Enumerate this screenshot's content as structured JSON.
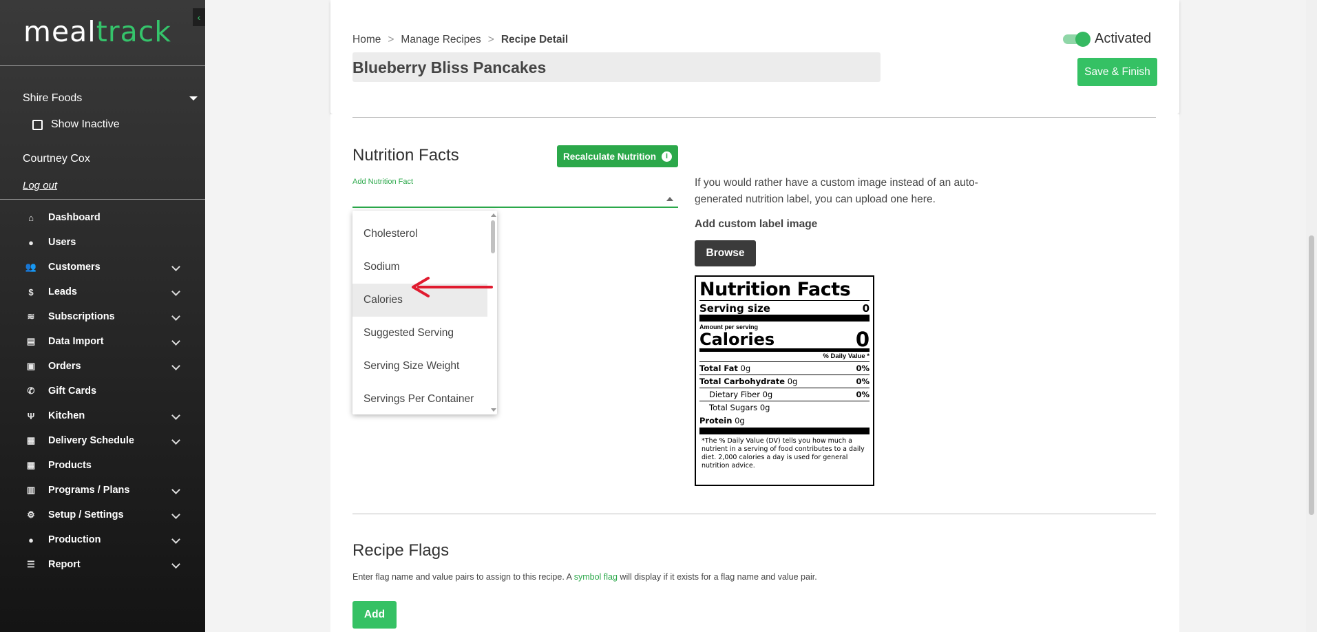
{
  "brand": {
    "part1": "meal",
    "part2": "track",
    "accent": "#35c46b"
  },
  "sidebar": {
    "company": "Shire Foods",
    "show_inactive": "Show Inactive",
    "user_name": "Courtney Cox",
    "logout": "Log out",
    "items": [
      {
        "label": "Dashboard",
        "icon": "home-icon",
        "glyph": "⌂",
        "expandable": false
      },
      {
        "label": "Users",
        "icon": "user-icon",
        "glyph": "●",
        "expandable": false
      },
      {
        "label": "Customers",
        "icon": "users-icon",
        "glyph": "👥",
        "expandable": true
      },
      {
        "label": "Leads",
        "icon": "dollar-icon",
        "glyph": "$",
        "expandable": true
      },
      {
        "label": "Subscriptions",
        "icon": "layers-icon",
        "glyph": "≋",
        "expandable": true
      },
      {
        "label": "Data Import",
        "icon": "file-icon",
        "glyph": "▤",
        "expandable": true
      },
      {
        "label": "Orders",
        "icon": "bag-icon",
        "glyph": "▣",
        "expandable": true
      },
      {
        "label": "Gift Cards",
        "icon": "phone-icon",
        "glyph": "✆",
        "expandable": false
      },
      {
        "label": "Kitchen",
        "icon": "utensils-icon",
        "glyph": "Ψ",
        "expandable": true
      },
      {
        "label": "Delivery Schedule",
        "icon": "calendar-icon",
        "glyph": "▦",
        "expandable": true
      },
      {
        "label": "Products",
        "icon": "calendar-icon",
        "glyph": "▦",
        "expandable": false
      },
      {
        "label": "Programs / Plans",
        "icon": "clipboard-icon",
        "glyph": "▥",
        "expandable": true
      },
      {
        "label": "Setup / Settings",
        "icon": "gear-icon",
        "glyph": "⚙",
        "expandable": true
      },
      {
        "label": "Production",
        "icon": "user-icon",
        "glyph": "●",
        "expandable": true
      },
      {
        "label": "Report",
        "icon": "list-icon",
        "glyph": "☰",
        "expandable": true
      }
    ]
  },
  "header": {
    "breadcrumb": [
      "Home",
      "Manage Recipes",
      "Recipe Detail"
    ],
    "breadcrumb_sep": ">",
    "title": "Blueberry Bliss Pancakes",
    "status": "Activated",
    "save_label": "Save & Finish"
  },
  "nutrition": {
    "heading": "Nutrition Facts",
    "recalc_label": "Recalculate Nutrition",
    "add_label": "Add Nutrition Fact",
    "dropdown_options": [
      "Cholesterol",
      "Sodium",
      "Calories",
      "Suggested Serving",
      "Serving Size Weight",
      "Servings Per Container"
    ],
    "highlighted_option": "Calories",
    "custom_text": "If you would rather have a custom image instead of an auto-generated nutrition label, you can upload one here.",
    "custom_label": "Add custom label image",
    "browse_label": "Browse"
  },
  "label": {
    "title": "Nutrition Facts",
    "serving_size": "Serving size",
    "serving_value": "0",
    "amount_per": "Amount per serving",
    "calories": "Calories",
    "calories_value": "0",
    "dv_header": "% Daily Value *",
    "total_fat": "Total Fat",
    "total_fat_v": "0g",
    "total_fat_dv": "0%",
    "total_carb": "Total Carbohydrate",
    "total_carb_v": "0g",
    "total_carb_dv": "0%",
    "fiber": "Dietary Fiber",
    "fiber_v": "0g",
    "fiber_dv": "0%",
    "sugars": "Total Sugars",
    "sugars_v": "0g",
    "protein": "Protein",
    "protein_v": "0g",
    "footnote": "*The % Daily Value (DV) tells you how much a nutrient in a serving of food contributes to a daily diet. 2,000 calories a day is used for general nutrition advice."
  },
  "flags": {
    "heading": "Recipe Flags",
    "desc_before": "Enter flag name and value pairs to assign to this recipe. A ",
    "desc_link": "symbol flag",
    "desc_after": " will display if it exists for a flag name and value pair.",
    "add_label": "Add"
  }
}
